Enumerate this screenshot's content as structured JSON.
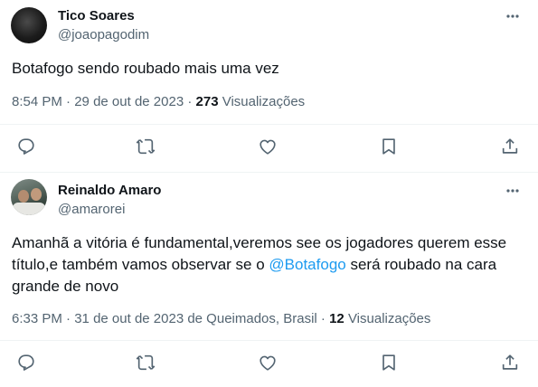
{
  "tweets": [
    {
      "author_name": "Tico Soares",
      "handle": "@joaopagodim",
      "text": "Botafogo sendo roubado mais uma vez",
      "time": "8:54 PM",
      "date": "29 de out de 2023",
      "views_count": "273",
      "views_label": "Visualizações"
    },
    {
      "author_name": "Reinaldo Amaro",
      "handle": "@amarorei",
      "text_line1": "Amanhã a vitória é fundamental,veremos see os jogadores querem esse",
      "text_line2_pre": "título,e também vamos observar se o ",
      "mention": "@Botafogo",
      "text_line2_post": " será roubado na cara",
      "text_line3": "grande de novo",
      "time": "6:33 PM",
      "date": "31 de out de 2023 de Queimados, Brasil",
      "views_count": "12",
      "views_label": "Visualizações"
    }
  ],
  "icons": {
    "reply": "reply-icon",
    "retweet": "retweet-icon",
    "like": "like-icon",
    "bookmark": "bookmark-icon",
    "share": "share-icon",
    "more": "more-icon"
  },
  "colors": {
    "text": "#0f1419",
    "secondary": "#536471",
    "link": "#1d9bf0",
    "divider": "#eff3f4"
  }
}
